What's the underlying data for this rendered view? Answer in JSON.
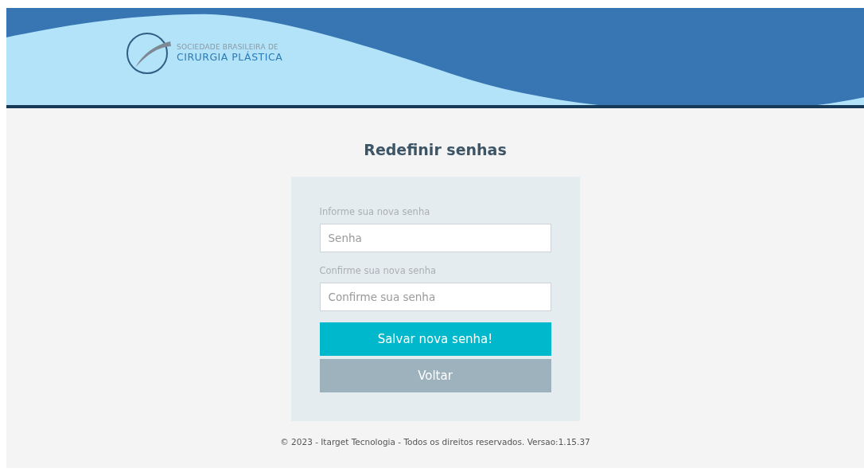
{
  "header": {
    "logo_line_1": "SOCIEDADE BRASILEIRA DE",
    "logo_line_2": "CIRURGIA PLÁSTICA"
  },
  "title": "Redefinir senhas",
  "form": {
    "fields": [
      {
        "label": "Informe sua nova senha",
        "placeholder": "Senha"
      },
      {
        "label": "Confirme sua nova senha",
        "placeholder": "Confirme sua senha"
      }
    ],
    "buttons": [
      {
        "label": "Salvar nova senha!",
        "kind": "primary"
      },
      {
        "label": "Voltar",
        "kind": "secondary"
      }
    ]
  },
  "footer": "© 2023 - Itarget Tecnologia - Todos os direitos reservados. Versao:1.15.37"
}
